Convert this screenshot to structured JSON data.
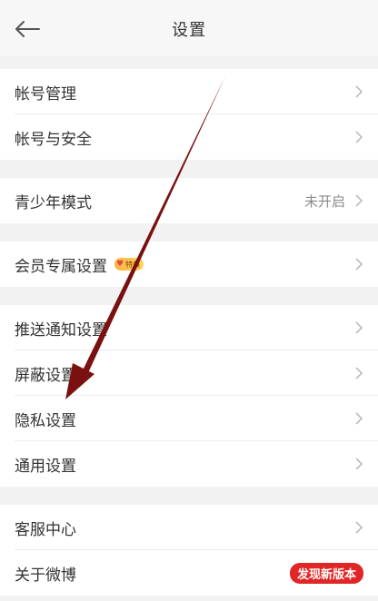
{
  "header": {
    "title": "设置",
    "back_icon": "back-arrow-icon"
  },
  "groups": [
    {
      "items": [
        {
          "label": "帐号管理"
        },
        {
          "label": "帐号与安全"
        }
      ]
    },
    {
      "items": [
        {
          "label": "青少年模式",
          "value": "未开启"
        }
      ]
    },
    {
      "items": [
        {
          "label": "会员专属设置",
          "badge": "特典"
        }
      ]
    },
    {
      "items": [
        {
          "label": "推送通知设置"
        },
        {
          "label": "屏蔽设置"
        },
        {
          "label": "隐私设置"
        },
        {
          "label": "通用设置"
        }
      ]
    },
    {
      "items": [
        {
          "label": "客服中心"
        },
        {
          "label": "关于微博",
          "badge": "发现新版本"
        }
      ]
    }
  ],
  "colors": {
    "background": "#f2f2f2",
    "badge_red": "#e02626",
    "annotation_arrow": "#7a1010"
  }
}
